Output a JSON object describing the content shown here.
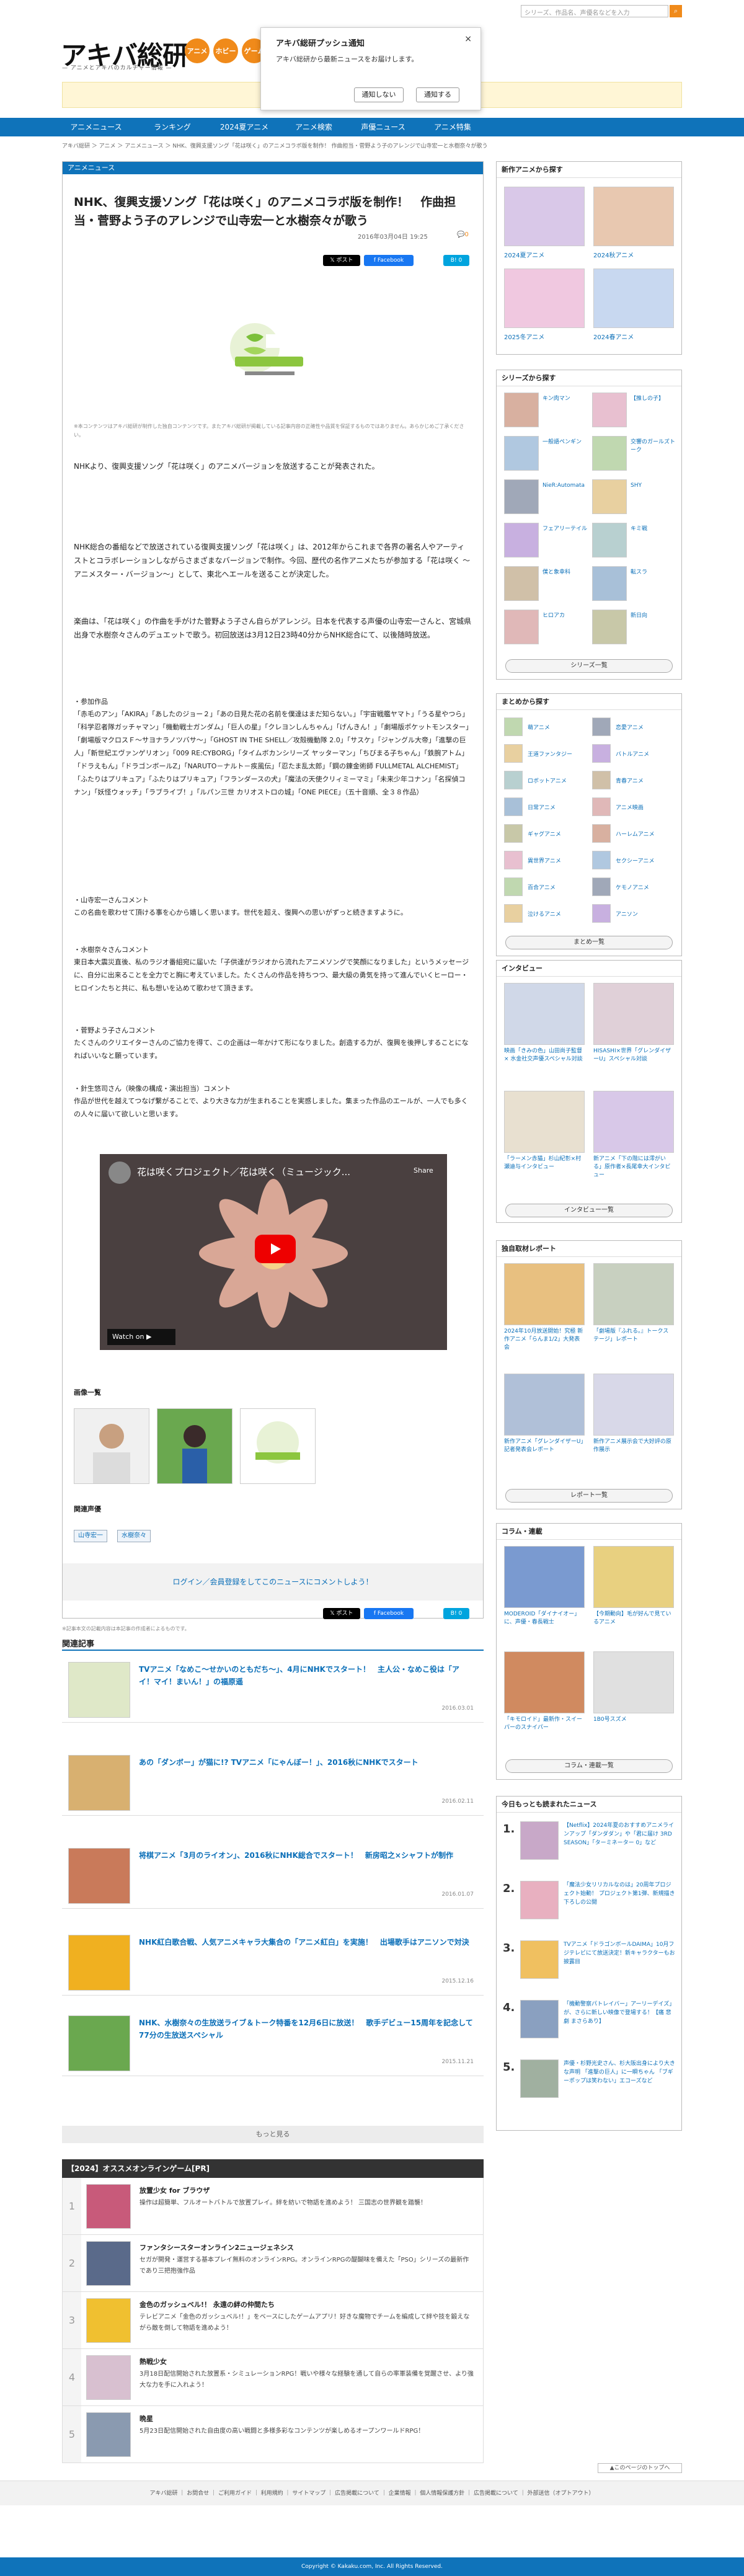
{
  "header": {
    "logo": "アキバ総研",
    "logo_sub": "— アニメとアキバのカルチャー情報 —",
    "categories": [
      "アニメ",
      "ホビー",
      "ゲーム"
    ],
    "search_placeholder": "シリーズ、作品名、声優名などを入力",
    "search_icon": "search-icon"
  },
  "popup": {
    "title": "アキバ総研プッシュ通知",
    "body": "アキバ総研から最新ニュースをお届けします。",
    "deny": "通知しない",
    "allow": "通知する",
    "close": "×"
  },
  "nav": [
    "アニメニュース",
    "ランキング",
    "2024夏アニメ",
    "アニメ検索",
    "声優ニュース",
    "アニメ特集"
  ],
  "breadcrumb": "アキバ総研 ＞ アニメ ＞ アニメニュース ＞ NHK、復興支援ソング「花は咲く」のアニメコラボ版を制作！ 作曲担当・菅野よう子のアレンジで山寺宏一と水樹奈々が歌う",
  "article": {
    "section": "アニメニュース",
    "title": "NHK、復興支援ソング「花は咲く」のアニメコラボ版を制作！　作曲担当・菅野よう子のアレンジで山寺宏一と水樹奈々が歌う",
    "date": "2016年03月04日 19:25",
    "comment_count": "0",
    "share": {
      "post": "ポスト",
      "facebook": "Facebook",
      "hatena": "B!",
      "count": "0"
    },
    "disclaimer": "※本コンテンツはアキバ総研が制作した独自コンテンツです。またアキバ総研が掲載している記事内容の正確性や品質を保証するものではありません。あらかじめご了承ください。",
    "lead": "NHKより、復興支援ソング「花は咲く」のアニメバージョンを放送することが発表された。",
    "body1": "NHK総合の番組などで放送されている復興支援ソング「花は咲く」は、2012年からこれまで各界の著名人やアーティストとコラボレーションしながらさまざまなバージョンで制作。今回、歴代の名作アニメたちが参加する「花は咲く ～アニメスター・バージョン～」として、東北へエールを送ることが決定した。",
    "body2": "楽曲は、「花は咲く」の作曲を手がけた菅野よう子さん自らがアレンジ。日本を代表する声優の山寺宏一さんと、宮城県出身で水樹奈々さんのデュエットで歌う。初回放送は3月12日23時40分からNHK総合にて、以後随時放送。",
    "works_h": "・参加作品",
    "works": "「赤毛のアン」「AKIRA」「あしたのジョー２」「あの日見た花の名前を僕達はまだ知らない。」「宇宙戦艦ヤマト」「うる星やつら」「科学忍者隊ガッチャマン」「機動戦士ガンダム」「巨人の星」「クレヨンしんちゃん」「げんきん！」「劇場版ポケットモンスター」「劇場版マクロスＦ～サヨナラノツバサ～」「GHOST IN THE SHELL／攻殻機動隊 2.0」「サスケ」「ジャングル大帝」「進撃の巨人」「新世紀エヴァンゲリオン」「009 RE:CYBORG」「タイムボカンシリーズ ヤッターマン」「ちびまる子ちゃん」「鉄腕アトム」「ドラえもん」「ドラゴンボールZ」「NARUTO－ナルト－疾風伝」「忍たま乱太郎」「鋼の錬金術師 FULLMETAL ALCHEMIST」「ふたりはプリキュア」「ふたりはプリキュア」「フランダースの犬」「魔法の天使クリィミーマミ」「未来少年コナン」「名探偵コナン」「妖怪ウォッチ」「ラブライブ！」「ルパン三世 カリオストロの城」「ONE PIECE」（五十音順、全３８作品）",
    "c1_h": "・山寺宏一さんコメント",
    "c1": "この名曲を歌わせて頂ける事を心から嬉しく思います。世代を超え、復興への思いがずっと続きますように。",
    "c2_h": "・水樹奈々さんコメント",
    "c2": "東日本大震災直後、私のラジオ番組宛に届いた「子供達がラジオから流れたアニメソングで笑顔になりました」というメッセージに、自分に出来ることを全力でと胸に考えていました。たくさんの作品を持ちつつ、最大級の勇気を持って進んでいくヒーロー・ヒロインたちと共に、私も想いを込めて歌わせて頂きます。",
    "c3_h": "・菅野よう子さんコメント",
    "c3": "たくさんのクリエイターさんのご協力を得て、この企画は一年かけて形になりました。創造する力が、復興を後押しすることになればいいなと願っています。",
    "c4_h": "・針生悠司さん（映像の構成・演出担当）コメント",
    "c4": "作品が世代を越えてつなげ繋がることで、より大きな力が生まれることを実感しました。集まった作品のエールが、一人でも多くの人々に届いて欲しいと思います。",
    "video_title": "花は咲くプロジェクト／花は咲く（ミュージック...",
    "video_share": "Share",
    "video_watch": "Watch on ▶ YouTube",
    "images_h": "画像一覧",
    "voice_h": "関連声優",
    "voices": [
      "山寺宏一",
      "水樹奈々"
    ],
    "login_text": "ログイン／会員登録をしてこのニュースにコメントしよう！",
    "note": "※記事本文の記載内容は本記事の作成者によるものです。"
  },
  "related": {
    "heading": "関連記事",
    "items": [
      {
        "title": "TVアニメ「なめこ～せかいのともだち～」、4月にNHKでスタート！　主人公・なめこ役は「アイ！マイ！まいん！」の福原遥",
        "date": "2016.03.01"
      },
      {
        "title": "あの「ダンボー」が猫に!? TVアニメ「にゃんぼー！」、2016秋にNHKでスタート",
        "date": "2016.02.11"
      },
      {
        "title": "将棋アニメ「3月のライオン」、2016秋にNHK総合でスタート！　新房昭之×シャフトが制作",
        "date": "2016.01.07"
      },
      {
        "title": "NHK紅白歌合戦、人気アニメキャラ大集合の「アニメ紅白」を実施！　出場歌手はアニソンで対決",
        "date": "2015.12.16"
      },
      {
        "title": "NHK、水樹奈々の生放送ライブ＆トーク特番を12月6日に放送！　歌手デビュー15周年を記念して77分の生放送スペシャル",
        "date": "2015.11.21"
      }
    ],
    "more": "もっと見る"
  },
  "games": {
    "heading": "【2024】オススメオンラインゲーム[PR]",
    "items": [
      {
        "rank": "1",
        "title": "放置少女 for ブラウザ",
        "desc": "操作は超簡単、フルオートバトルで放置プレイ。絆を紡いで物語を進めよう！ 三国志の世界観を踏襲！"
      },
      {
        "rank": "2",
        "title": "ファンタシースターオンライン2ニュージェネシス",
        "desc": "セガが開発・運営する基本プレイ無料のオンラインRPG。オンラインRPGの醍醐味を備えた「PSO」シリーズの最新作であり三把抱強作品"
      },
      {
        "rank": "3",
        "title": "金色のガッシュベル!！ 永遠の絆の仲間たち",
        "desc": "テレビアニメ「金色のガッシュベル!！」をベースにしたゲームアプリ！好きな魔物でチームを編成して絆や技を鍛えながら敵を倒して物語を進めよう！"
      },
      {
        "rank": "4",
        "title": "熱戦少女",
        "desc": "3月18日配信開始された放置系・シミュレーションRPG！戦いや様々な経験を通して自らの率軍装備を覚醒させ、より強大な力を手に入れよう！"
      },
      {
        "rank": "5",
        "title": "晩星",
        "desc": "5月23日配信開始された自由度の高い戦闘と多様多彩なコンテンツが楽しめるオープンワールドRPG！"
      }
    ]
  },
  "sidebar": {
    "new_anime": {
      "heading": "新作アニメから探す",
      "items": [
        "2024夏アニメ",
        "2024秋アニメ",
        "2025冬アニメ",
        "2024春アニメ"
      ]
    },
    "series": {
      "heading": "シリーズから探す",
      "items": [
        "キン肉マン",
        "【推しの子】",
        "一般語ペンギン",
        "交響のガールズトーク",
        "NieR:Automata",
        "SHY",
        "フェアリーテイル",
        "キミ戦",
        "僕と象幸科",
        "転スラ",
        "ヒロアカ",
        "新日向"
      ],
      "button": "シリーズ一覧"
    },
    "matome": {
      "heading": "まとめから探す",
      "items": [
        "萌アニメ",
        "恋愛アニメ",
        "王道ファンタジー",
        "バトルアニメ",
        "ロボットアニメ",
        "青春アニメ",
        "日常アニメ",
        "アニメ映画",
        "ギャグアニメ",
        "ハーレムアニメ",
        "異世界アニメ",
        "セクシーアニメ",
        "百合アニメ",
        "ケモノアニメ",
        "泣けるアニメ",
        "アニソン"
      ],
      "button": "まとめ一覧"
    },
    "interview": {
      "heading": "インタビュー",
      "items": [
        "映画「きみの色」山田尚子監督 × 水金社交声優スペシャル対談",
        "HISASHI×世界「グレンダイザーU」スペシャル対談",
        "「ラーメン赤猫」杉山紀彰×村瀬迪与インタビュー",
        "新アニメ「下の階には澪がいる」原作者×長尾幸大インタビュー"
      ],
      "button": "インタビュー一覧"
    },
    "report": {
      "heading": "独自取材レポート",
      "items": [
        "2024年10月放送開始！究極 新作アニメ「らんま1/2」大発表会",
        "「劇場版『ふれる。』トークステージ」レポート",
        "新作アニメ「グレンダイザーU」記者発表会レポート",
        "新作アニメ展示会で大好評の原作展示"
      ],
      "button": "レポート一覧"
    },
    "column": {
      "heading": "コラム・連載",
      "items": [
        "MODEROID「ダイナイオー」に、声優・春長戦士",
        "【今期動向】毛が好んで見ているアニメ",
        "「キモロイド」最新作・スイーパーのスナイパー",
        "1B0号スズメ"
      ],
      "button": "コラム・連載一覧"
    },
    "ranking": {
      "heading": "今日もっとも読まれたニュース",
      "items": [
        {
          "rank": "1.",
          "title": "【Netflix】2024年夏のおすすめアニメラインアップ「ダンダダン」や「君に届け 3RD SEASON」「ターミネーター 0」など"
        },
        {
          "rank": "2.",
          "title": "「魔法少女リリカルなのは」20周年プロジェクト始動！ プロジェクト第1弾、新規描き下ろしの公開"
        },
        {
          "rank": "3.",
          "title": "TVアニメ「ドラゴンボールDAIMA」10月フジテレビにて放送決定！新キャラクターもお披露目"
        },
        {
          "rank": "4.",
          "title": "「機動警察パトレイバー」アーリーデイズ」が、さらに新しい映像で登場する！【痛 悲劇 まさらあり】"
        },
        {
          "rank": "5.",
          "title": "声優・杉野光史さん、杉大阪出身により大きな声明 「進撃の巨人」に一瞬ちゃん 「ブギーポップは笑わない」エコーズなど"
        }
      ]
    }
  },
  "footer": {
    "pagetop": "▲このページのトップへ",
    "links": "アキバ総研 ｜ お問合せ ｜ ご利用ガイド ｜ 利用規約 ｜ サイトマップ ｜ 広告掲載について ｜ 企業情報 ｜ 個人情報保護方針 ｜ 広告掲載について ｜ 外部送信（オプトアウト）",
    "copyright": "Copyright © Kakaku.com, Inc. All Rights Reserved."
  },
  "colors": {
    "brand_blue": "#0f73ba",
    "accent_orange": "#f08a1a"
  }
}
